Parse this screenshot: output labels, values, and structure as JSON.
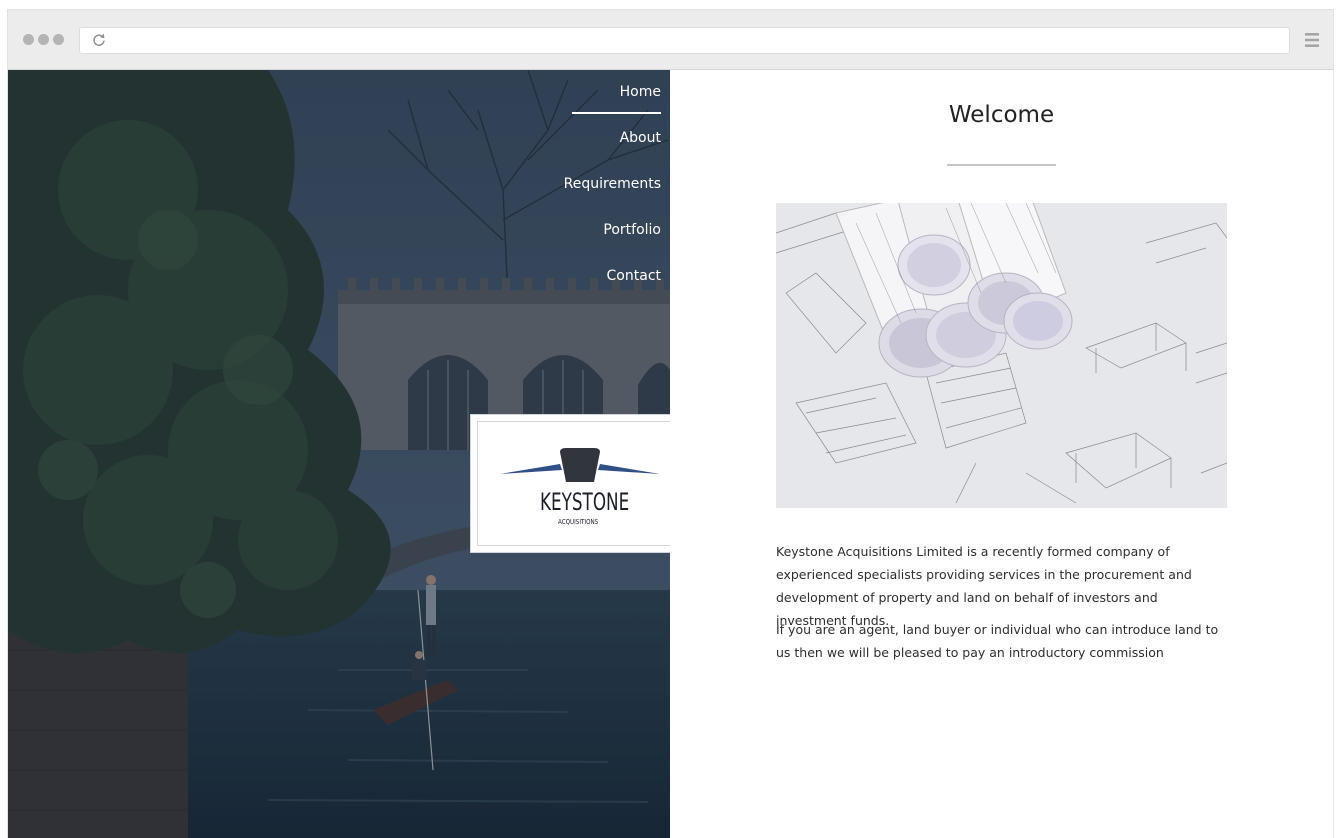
{
  "browser": {
    "url": "",
    "reload_icon": "reload-icon",
    "menu_icon": "hamburger-menu-icon"
  },
  "nav": {
    "items": [
      {
        "label": "Home",
        "active": true
      },
      {
        "label": "About",
        "active": false
      },
      {
        "label": "Requirements",
        "active": false
      },
      {
        "label": "Portfolio",
        "active": false
      },
      {
        "label": "Contact",
        "active": false
      }
    ]
  },
  "logo": {
    "name": "KEYSTONE",
    "subtitle": "ACQUISITIONS"
  },
  "main": {
    "title": "Welcome",
    "image": "blueprint-rolls-image",
    "paragraphs": [
      "Keystone Acquisitions Limited is a recently formed company of experienced specialists providing services in the procurement and development of property and land on behalf of investors and investment funds.",
      "If you are an agent, land buyer or individual who can introduce land to us then we will be pleased to pay an introductory commission"
    ]
  },
  "colors": {
    "overlay": "#1d2d3f",
    "logo_blue": "#2f4f86",
    "text": "#2e2e2e",
    "chrome": "#ececec"
  }
}
